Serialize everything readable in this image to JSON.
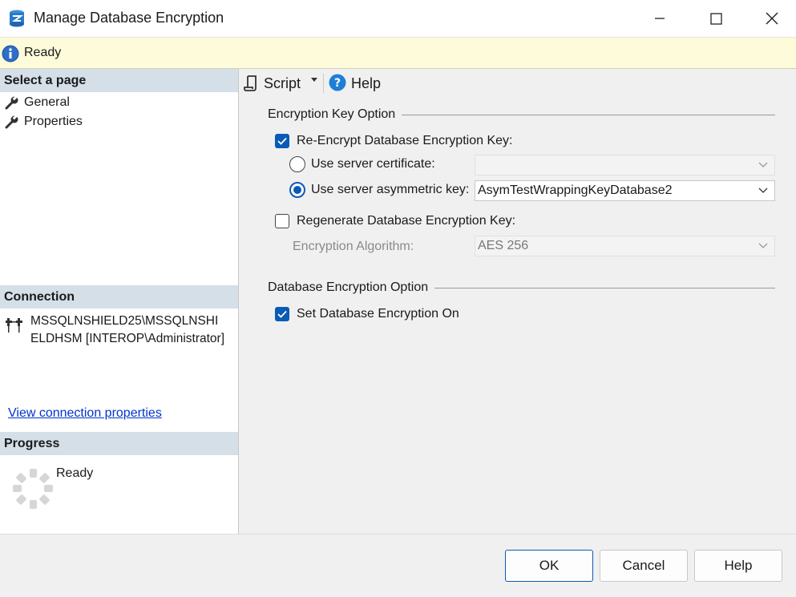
{
  "window": {
    "title": "Manage Database Encryption"
  },
  "status": {
    "text": "Ready"
  },
  "left": {
    "select_page_header": "Select a page",
    "pages": [
      {
        "label": "General"
      },
      {
        "label": "Properties"
      }
    ],
    "connection_header": "Connection",
    "connection_line1": "MSSQLNSHIELD25\\MSSQLNSHI",
    "connection_line2": "ELDHSM [INTEROP\\Administrator]",
    "view_connection_link": "View connection properties",
    "progress_header": "Progress",
    "progress_text": "Ready"
  },
  "toolbar": {
    "script_label": "Script",
    "help_label": "Help"
  },
  "encryption_key_option": {
    "group_title": "Encryption Key Option",
    "reencrypt_label": "Re-Encrypt Database Encryption Key:",
    "reencrypt_checked": true,
    "server_certificate_label": "Use server certificate:",
    "server_certificate_value": "",
    "asymmetric_key_label": "Use server asymmetric key:",
    "asymmetric_key_value": "AsymTestWrappingKeyDatabase2",
    "selected_option": "asymmetric_key",
    "regenerate_label": "Regenerate Database Encryption Key:",
    "regenerate_checked": false,
    "algorithm_label": "Encryption Algorithm:",
    "algorithm_value": "AES 256"
  },
  "database_encryption_option": {
    "group_title": "Database Encryption Option",
    "set_on_label": "Set Database Encryption On",
    "set_on_checked": true
  },
  "buttons": {
    "ok": "OK",
    "cancel": "Cancel",
    "help": "Help"
  },
  "colors": {
    "accent": "#0a5bb5",
    "status_bg": "#fdfbd9",
    "section_header_bg": "#d5dfe8",
    "link": "#0033cc"
  }
}
